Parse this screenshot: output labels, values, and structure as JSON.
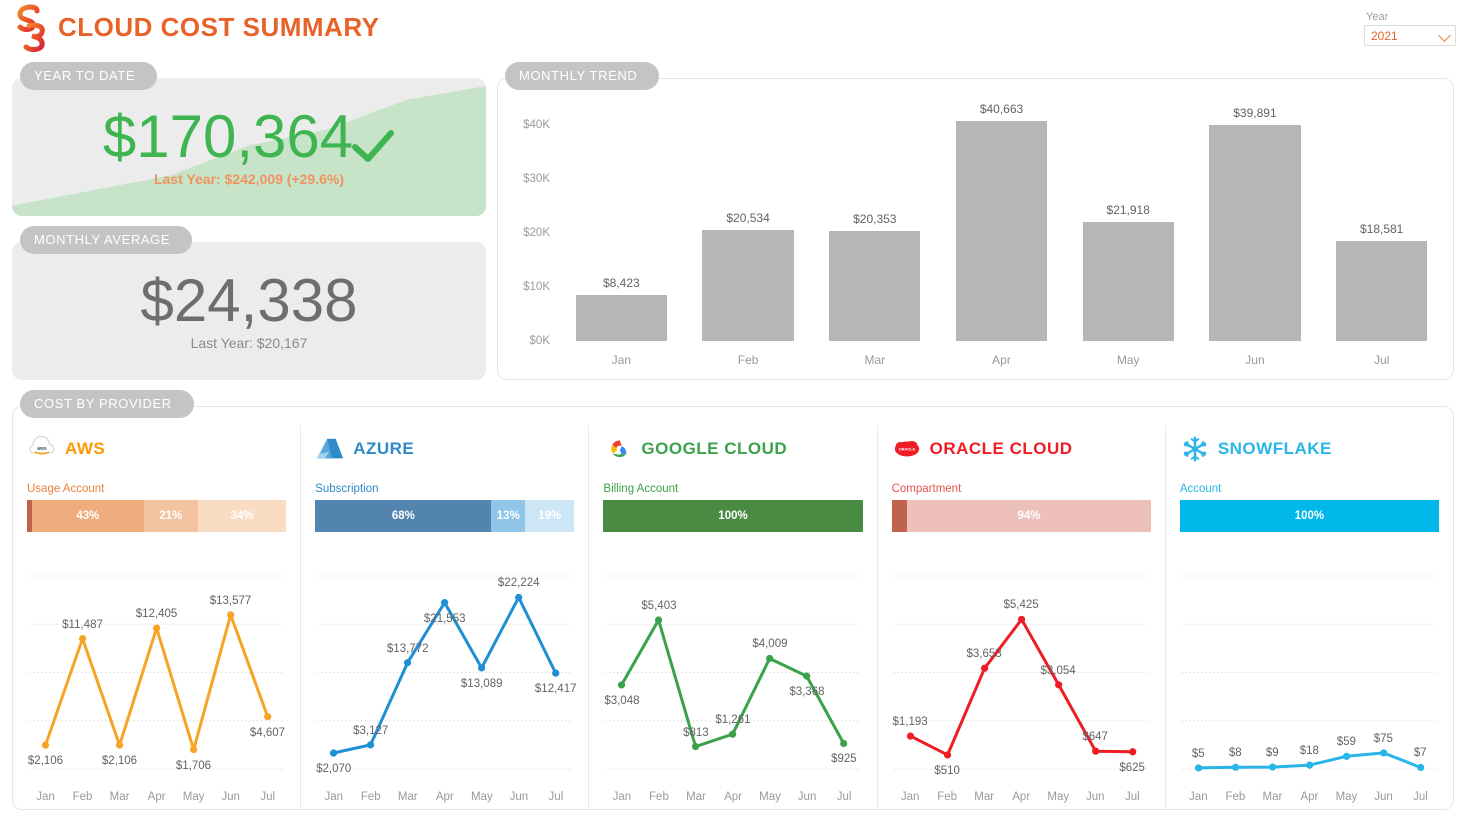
{
  "header": {
    "title": "CLOUD COST SUMMARY",
    "logo_icon": "s3-logo-icon",
    "year_label": "Year",
    "year_value": "2021",
    "chevron_icon": "chevron-down-icon"
  },
  "ytd": {
    "badge": "YEAR TO DATE",
    "value": "$170,364",
    "check_icon": "check-icon",
    "sub_label": "Last Year:",
    "sub_value": "$242,009 (+29.6%)",
    "sub_full": "Last Year: $242,009 (+29.6%)",
    "color": "#3fb551",
    "sub_color": "#f0945f"
  },
  "monthly_average": {
    "badge": "MONTHLY AVERAGE",
    "value": "$24,338",
    "sub_label": "Last Year:",
    "sub_value": "$20,167",
    "sub_full": "Last Year: $20,167",
    "color": "#6e6e6e"
  },
  "trend": {
    "badge": "MONTHLY TREND"
  },
  "providers_panel": {
    "badge": "COST BY PROVIDER"
  },
  "chart_data": [
    {
      "id": "monthly-trend",
      "type": "bar",
      "title": "MONTHLY TREND",
      "categories": [
        "Jan",
        "Feb",
        "Mar",
        "Apr",
        "May",
        "Jun",
        "Jul"
      ],
      "values": [
        8423,
        20534,
        20353,
        40663,
        21918,
        39891,
        18581
      ],
      "labels": [
        "$8,423",
        "$20,534",
        "$20,353",
        "$40,663",
        "$21,918",
        "$39,891",
        "$18,581"
      ],
      "ytick_labels": [
        "$40K",
        "$30K",
        "$20K",
        "$10K",
        "$0K"
      ],
      "ytick_values": [
        40000,
        30000,
        20000,
        10000,
        0
      ],
      "ylim": [
        0,
        44000
      ],
      "xlabel": "",
      "ylabel": "",
      "grid": false,
      "bar_color": "#b6b6b6"
    },
    {
      "id": "ytd-sparkline",
      "type": "area",
      "title": "YEAR TO DATE",
      "x": [
        "Jan",
        "Feb",
        "Mar",
        "Apr",
        "May",
        "Jun",
        "Jul"
      ],
      "values": [
        8423,
        28957,
        49310,
        89973,
        111891,
        151782,
        170364
      ],
      "fill_color": "#c7e3c8",
      "ylim": [
        0,
        170364
      ]
    },
    {
      "id": "aws-trend",
      "type": "line",
      "title": "AWS",
      "categories": [
        "Jan",
        "Feb",
        "Mar",
        "Apr",
        "May",
        "Jun",
        "Jul"
      ],
      "values": [
        2106,
        11487,
        2106,
        12405,
        1706,
        13577,
        4607
      ],
      "labels": [
        "$2,106",
        "$11,487",
        "$2,106",
        "$12,405",
        "$1,706",
        "$13,577",
        "$4,607"
      ],
      "label_pos": [
        "below",
        "above",
        "below",
        "above",
        "below",
        "above",
        "below"
      ],
      "color": "#f7a426",
      "ylim": [
        0,
        17000
      ],
      "grid": true
    },
    {
      "id": "azure-trend",
      "type": "line",
      "title": "AZURE",
      "categories": [
        "Jan",
        "Feb",
        "Mar",
        "Apr",
        "May",
        "Jun",
        "Jul"
      ],
      "values": [
        2070,
        3127,
        13772,
        21553,
        13089,
        22224,
        12417
      ],
      "labels": [
        "$2,070",
        "$3,127",
        "$13,772",
        "$21,553",
        "$13,089",
        "$22,224",
        "$12,417"
      ],
      "label_pos": [
        "below",
        "above",
        "above",
        "below",
        "below",
        "above",
        "below"
      ],
      "color": "#1e8fd5",
      "ylim": [
        0,
        25000
      ],
      "grid": true
    },
    {
      "id": "gcp-trend",
      "type": "line",
      "title": "GOOGLE CLOUD",
      "categories": [
        "Jan",
        "Feb",
        "Mar",
        "Apr",
        "May",
        "Jun",
        "Jul"
      ],
      "values": [
        3048,
        5403,
        813,
        1261,
        4009,
        3368,
        925
      ],
      "labels": [
        "$3,048",
        "$5,403",
        "$813",
        "$1,261",
        "$4,009",
        "$3,368",
        "$925"
      ],
      "label_pos": [
        "below",
        "above",
        "above",
        "above",
        "above",
        "below",
        "below"
      ],
      "color": "#3aa24a",
      "ylim": [
        0,
        7000
      ],
      "grid": true
    },
    {
      "id": "oracle-trend",
      "type": "line",
      "title": "ORACLE CLOUD",
      "categories": [
        "Jan",
        "Feb",
        "Mar",
        "Apr",
        "May",
        "Jun",
        "Jul"
      ],
      "values": [
        1193,
        510,
        3653,
        5425,
        3054,
        647,
        625
      ],
      "labels": [
        "$1,193",
        "$510",
        "$3,653",
        "$5,425",
        "$3,054",
        "$647",
        "$625"
      ],
      "label_pos": [
        "above",
        "below",
        "above",
        "above",
        "above",
        "above",
        "below"
      ],
      "color": "#ee1c25",
      "ylim": [
        0,
        7000
      ],
      "grid": true
    },
    {
      "id": "snowflake-trend",
      "type": "line",
      "title": "SNOWFLAKE",
      "categories": [
        "Jan",
        "Feb",
        "Mar",
        "Apr",
        "May",
        "Jun",
        "Jul"
      ],
      "values": [
        5,
        8,
        9,
        18,
        59,
        75,
        7
      ],
      "labels": [
        "$5",
        "$8",
        "$9",
        "$18",
        "$59",
        "$75",
        "$7"
      ],
      "label_pos": [
        "above",
        "above",
        "above",
        "above",
        "above",
        "above",
        "above"
      ],
      "color": "#29b5e8",
      "ylim": [
        0,
        900
      ],
      "grid": true
    }
  ],
  "providers": [
    {
      "key": "aws",
      "name": "AWS",
      "logo_icon": "aws-cloud-icon",
      "name_color": "#f90",
      "dimension_label": "Usage Account",
      "dimension_color": "#e8833a",
      "segments": [
        {
          "label": "",
          "pct": 2,
          "color": "#c0634d"
        },
        {
          "label": "43%",
          "pct": 43,
          "color": "#efad7e"
        },
        {
          "label": "21%",
          "pct": 21,
          "color": "#f4c4a0"
        },
        {
          "label": "34%",
          "pct": 34,
          "color": "#fadcc3"
        }
      ]
    },
    {
      "key": "azure",
      "name": "AZURE",
      "logo_icon": "azure-triangle-icon",
      "name_color": "#2e8bc8",
      "dimension_label": "Subscription",
      "dimension_color": "#2e8bc8",
      "segments": [
        {
          "label": "68%",
          "pct": 68,
          "color": "#5284ae"
        },
        {
          "label": "13%",
          "pct": 13,
          "color": "#90c6e8"
        },
        {
          "label": "19%",
          "pct": 19,
          "color": "#cde6f5"
        }
      ]
    },
    {
      "key": "gcp",
      "name": "GOOGLE CLOUD",
      "logo_icon": "google-cloud-icon",
      "name_color": "#3aa24a",
      "dimension_label": "Billing Account",
      "dimension_color": "#3aa24a",
      "segments": [
        {
          "label": "100%",
          "pct": 100,
          "color": "#4a8b44"
        }
      ]
    },
    {
      "key": "oracle",
      "name": "ORACLE CLOUD",
      "logo_icon": "oracle-cloud-icon",
      "name_color": "#ee1c25",
      "dimension_label": "Compartment",
      "dimension_color": "#e8544e",
      "segments": [
        {
          "label": "",
          "pct": 6,
          "color": "#c0634d"
        },
        {
          "label": "94%",
          "pct": 94,
          "color": "#eec0bb"
        }
      ]
    },
    {
      "key": "snowflake",
      "name": "SNOWFLAKE",
      "logo_icon": "snowflake-icon",
      "name_color": "#29b5e8",
      "dimension_label": "Account",
      "dimension_color": "#29b5e8",
      "segments": [
        {
          "label": "100%",
          "pct": 100,
          "color": "#00b8ea"
        }
      ]
    }
  ]
}
